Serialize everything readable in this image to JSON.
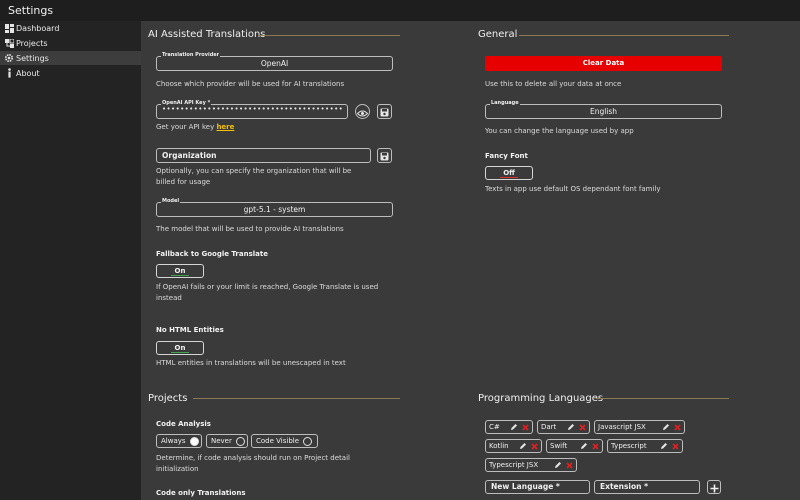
{
  "window": {
    "title": "Settings"
  },
  "sidebar": {
    "items": [
      {
        "label": "Dashboard",
        "icon": "dashboard-icon",
        "active": false
      },
      {
        "label": "Projects",
        "icon": "projects-icon",
        "active": false
      },
      {
        "label": "Settings",
        "icon": "gear-icon",
        "active": true
      },
      {
        "label": "About",
        "icon": "info-icon",
        "active": false
      }
    ]
  },
  "ai": {
    "title": "AI Assisted Translations",
    "provider": {
      "label": "Translation Provider",
      "value": "OpenAI",
      "desc": "Choose which provider will be used for AI translations"
    },
    "api_key": {
      "label": "OpenAI API Key *",
      "value": "••••••••••••••••••••••••••••••••••••••••••••••••••••",
      "desc_prefix": "Get your API key ",
      "desc_link": "here"
    },
    "organization": {
      "value": "Organization",
      "desc_line1": "Optionally, you can specify the organization that will be",
      "desc_line2": "billed for usage"
    },
    "model": {
      "label": "Model",
      "value": "gpt-5.1 - system",
      "desc": "The model that will be used to provide AI translations"
    },
    "fallback": {
      "label": "Fallback to Google Translate",
      "toggle": "On",
      "desc_line1": "If OpenAI fails or your limit is reached, Google Translate is used",
      "desc_line2": "instead"
    },
    "html_entities": {
      "label": "No HTML Entities",
      "toggle": "On",
      "desc": "HTML entities in translations will be unescaped in text"
    }
  },
  "general": {
    "title": "General",
    "clear_data": {
      "button": "Clear Data",
      "desc": "Use this to delete all your data at once"
    },
    "language": {
      "label": "Language",
      "value": "English",
      "desc": "You can change the language used by app"
    },
    "fancy_font": {
      "label": "Fancy Font",
      "toggle": "Off",
      "desc": "Texts in app use default OS dependant font family"
    }
  },
  "projects": {
    "title": "Projects",
    "code_analysis": {
      "label": "Code Analysis",
      "options": [
        {
          "label": "Always",
          "selected": true
        },
        {
          "label": "Never",
          "selected": false
        },
        {
          "label": "Code Visible",
          "selected": false
        }
      ],
      "desc_line1": "Determine, if code analysis should run on Project detail",
      "desc_line2": "initialization"
    },
    "code_only_translations": {
      "label": "Code only Translations"
    }
  },
  "programming": {
    "title": "Programming Languages",
    "languages": [
      "C#",
      "Dart",
      "Javascript JSX",
      "Kotlin",
      "Swift",
      "Typescript",
      "Typescript JSX"
    ],
    "new_language_placeholder": "New Language *",
    "extension_placeholder": "Extension *"
  },
  "colors": {
    "accent_red": "#e60000",
    "toggle_on_underline": "#3fa34d",
    "toggle_off_underline": "#d93030",
    "link": "#f5c000",
    "section_line": "#8a7a55",
    "delete_x": "#e02020"
  }
}
